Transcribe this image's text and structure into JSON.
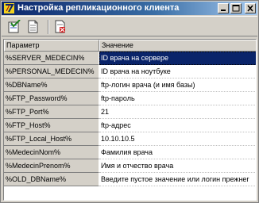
{
  "window": {
    "title": "Настройка репликационного клиента",
    "title_icon": "app-icon-yellow-7"
  },
  "toolbar": {
    "buttons": [
      {
        "icon": "check-save-icon",
        "label": ""
      },
      {
        "icon": "document-icon",
        "label": ""
      },
      {
        "icon": "delete-document-icon",
        "label": ""
      }
    ]
  },
  "table": {
    "headers": {
      "param": "Параметр",
      "value": "Значение"
    },
    "rows": [
      {
        "param": "%SERVER_MEDECIN%",
        "value": "ID врача на сервере",
        "selected": true
      },
      {
        "param": "%PERSONAL_MEDECIN%",
        "value": "ID врача на ноутбуке"
      },
      {
        "param": "%DBName%",
        "value": "ftp-логин врача (и имя базы)"
      },
      {
        "param": "%FTP_Password%",
        "value": "ftp-пароль"
      },
      {
        "param": "%FTP_Port%",
        "value": "21"
      },
      {
        "param": "%FTP_Host%",
        "value": "ftp-адрес"
      },
      {
        "param": "%FTP_Local_Host%",
        "value": "10.10.10.5"
      },
      {
        "param": "%MedecinNom%",
        "value": "Фамилия врача"
      },
      {
        "param": "%MedecinPrenom%",
        "value": "Имя и отчество врача"
      },
      {
        "param": "%OLD_DBName%",
        "value": "Введите пустое значение или логин прежнег"
      }
    ]
  },
  "colors": {
    "title_start": "#0a246a",
    "title_end": "#a6caf0",
    "selection": "#0a246a",
    "face": "#d4d0c8"
  }
}
